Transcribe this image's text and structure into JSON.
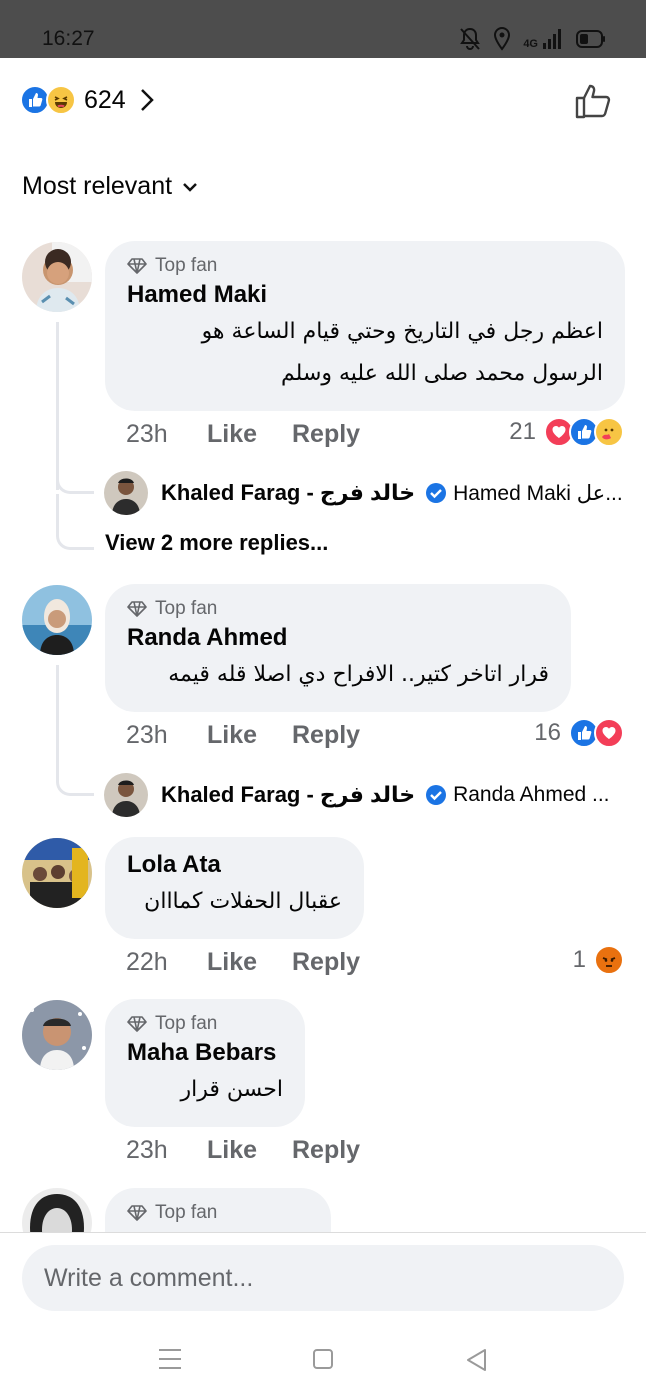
{
  "status_bar": {
    "time": "16:27",
    "network": "4G"
  },
  "header": {
    "reaction_count": "624",
    "reactions": [
      "like-icon",
      "haha-icon"
    ]
  },
  "sort": {
    "label": "Most relevant"
  },
  "comments": [
    {
      "badge": "Top fan",
      "author": "Hamed Maki",
      "text_line1": "اعظم رجل في التاريخ وحتي قيام الساعة هو",
      "text_line2": "الرسول محمد صلى الله عليه وسلم",
      "time": "23h",
      "like": "Like",
      "reply": "Reply",
      "reaction_count": "21",
      "reactions": [
        "love-icon",
        "like-icon",
        "care-icon"
      ],
      "reply_preview": {
        "name": "Khaled Farag - خالد فرج",
        "text": "Hamed Maki عل..."
      },
      "view_more": "View 2 more replies..."
    },
    {
      "badge": "Top fan",
      "author": "Randa Ahmed",
      "text_line1": "قرار اتاخر كتير.. الافراح دي اصلا قله قيمه",
      "time": "23h",
      "like": "Like",
      "reply": "Reply",
      "reaction_count": "16",
      "reactions": [
        "like-icon",
        "love-icon"
      ],
      "reply_preview": {
        "name": "Khaled Farag - خالد فرج",
        "text": "Randa Ahmed ..."
      }
    },
    {
      "author": "Lola Ata",
      "text_line1": "عقبال الحفلات كمااان",
      "time": "22h",
      "like": "Like",
      "reply": "Reply",
      "reaction_count": "1",
      "reactions": [
        "angry-icon"
      ]
    },
    {
      "badge": "Top fan",
      "author": "Maha Bebars",
      "text_line1": "احسن قرار",
      "time": "23h",
      "like": "Like",
      "reply": "Reply"
    },
    {
      "badge": "Top fan"
    }
  ],
  "composer": {
    "placeholder": "Write a comment..."
  }
}
